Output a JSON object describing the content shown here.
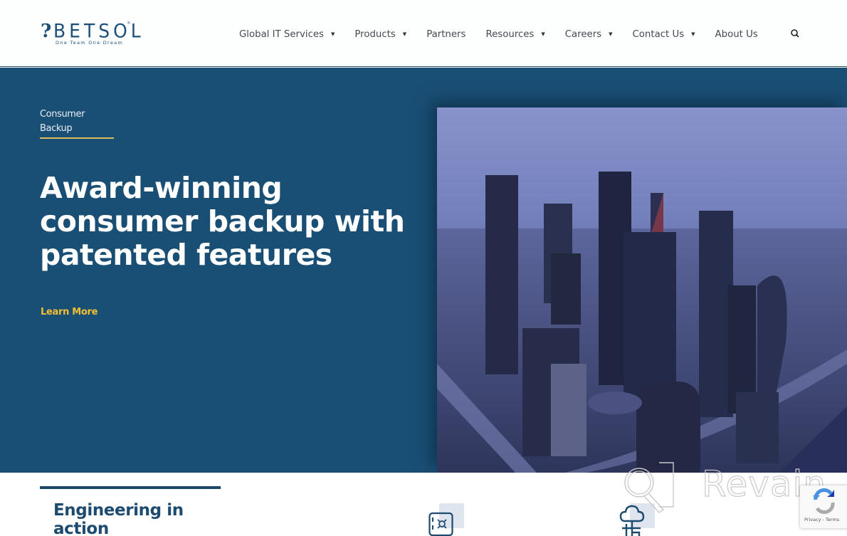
{
  "header": {
    "logo": {
      "mark": "?",
      "name": "BETSOL",
      "registered": "®",
      "tagline": "One Team One Dream"
    },
    "nav": [
      {
        "label": "Global IT Services",
        "has_dropdown": true,
        "caret": "▼"
      },
      {
        "label": "Products",
        "has_dropdown": true,
        "caret": "▼"
      },
      {
        "label": "Partners",
        "has_dropdown": false
      },
      {
        "label": "Resources",
        "has_dropdown": true,
        "caret": "▼"
      },
      {
        "label": "Careers",
        "has_dropdown": true,
        "caret": "▼"
      },
      {
        "label": "Contact Us",
        "has_dropdown": true,
        "caret": "▼"
      },
      {
        "label": "About Us",
        "has_dropdown": false
      }
    ],
    "search_icon": "search-icon"
  },
  "hero": {
    "eyebrow": "Consumer Backup",
    "headline": "Award-winning consumer backup with patented features",
    "cta": "Learn More",
    "image_alt": "Aerial view of city skyscrapers",
    "colors": {
      "background": "#1a4f75",
      "accent": "#f4bf32",
      "eyebrow_underline": "#d9bd5f"
    }
  },
  "section": {
    "title": "Engineering in action",
    "icons": [
      "safe-icon",
      "cloud-network-icon"
    ]
  },
  "watermark": {
    "text": "Revain"
  },
  "recaptcha": {
    "links": "Privacy - Terms"
  }
}
